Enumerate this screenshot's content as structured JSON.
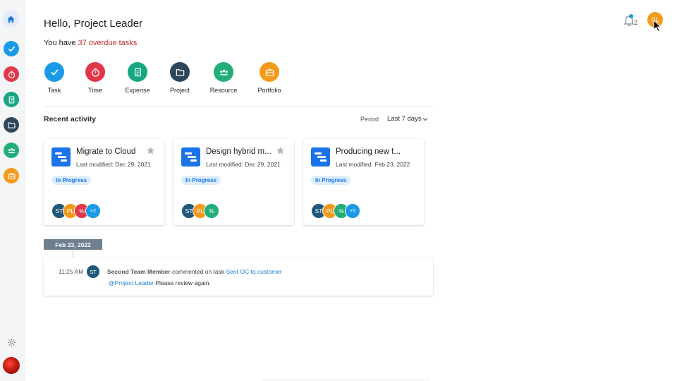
{
  "header": {
    "greeting": "Hello, Project Leader",
    "overdue_prefix": "You have ",
    "overdue_link": "37 overdue tasks",
    "notification_count": "2",
    "user_initials": "PL"
  },
  "quick_actions": [
    {
      "label": "Task",
      "icon": "check-icon",
      "color": "#1a9ae6"
    },
    {
      "label": "Time",
      "icon": "stopwatch-icon",
      "color": "#e0374b"
    },
    {
      "label": "Expense",
      "icon": "receipt-icon",
      "color": "#18a683"
    },
    {
      "label": "Project",
      "icon": "folder-icon",
      "color": "#2f4658"
    },
    {
      "label": "Resource",
      "icon": "people-icon",
      "color": "#20ae79"
    },
    {
      "label": "Portfolio",
      "icon": "briefcase-icon",
      "color": "#f39a1a"
    }
  ],
  "recent": {
    "title": "Recent activity",
    "period_label": "Period",
    "period_value": "Last 7 days"
  },
  "cards": [
    {
      "title": "Migrate to Cloud",
      "modified": "Last modified: Dec 29, 2021",
      "status": "In Progress",
      "members": [
        {
          "initials": "ST",
          "color": "#1f5878"
        },
        {
          "initials": "PL",
          "color": "#f39a1a"
        },
        {
          "initials": "%",
          "color": "#e0374b"
        },
        {
          "initials": "+2",
          "color": "#1a9ae6"
        }
      ]
    },
    {
      "title": "Design hybrid m...",
      "modified": "Last modified: Dec 29, 2021",
      "status": "In Progress",
      "members": [
        {
          "initials": "ST",
          "color": "#1f5878"
        },
        {
          "initials": "PL",
          "color": "#f39a1a"
        },
        {
          "initials": "%",
          "color": "#20ae79"
        }
      ]
    },
    {
      "title": "Producing new t...",
      "modified": "Last modified: Feb 23, 2022",
      "status": "In Progress",
      "members": [
        {
          "initials": "ST",
          "color": "#1f5878"
        },
        {
          "initials": "PL",
          "color": "#f39a1a"
        },
        {
          "initials": "%",
          "color": "#20ae79"
        },
        {
          "initials": "+5",
          "color": "#1a9ae6"
        }
      ]
    }
  ],
  "timeline": {
    "date": "Feb 23, 2022",
    "entry": {
      "time": "11:25 AM",
      "avatar_initials": "ST",
      "author": "Second Team Member",
      "action": " commented on task ",
      "task_link": "Sent OC to customer",
      "mention": "@Project Leader",
      "message": " Please review again."
    }
  }
}
